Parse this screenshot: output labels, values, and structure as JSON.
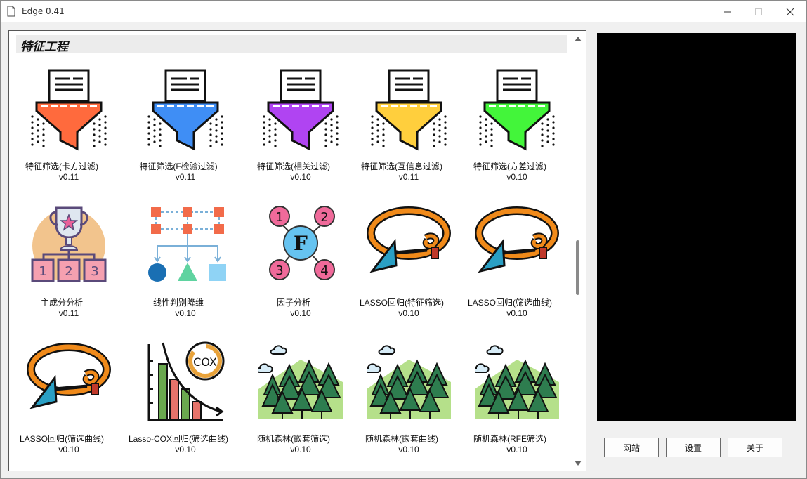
{
  "window": {
    "title": "Edge 0.41"
  },
  "section": {
    "title": "特征工程"
  },
  "items": [
    {
      "name": "特征筛选(卡方过滤)",
      "version": "v0.11",
      "icon": "funnel-filter-icon",
      "color": "#ff6a3d"
    },
    {
      "name": "特征筛选(F检验过滤)",
      "version": "v0.11",
      "icon": "funnel-filter-icon",
      "color": "#3f8ef5"
    },
    {
      "name": "特征筛选(相关过滤)",
      "version": "v0.10",
      "icon": "funnel-filter-icon",
      "color": "#b044f2"
    },
    {
      "name": "特征筛选(互信息过滤)",
      "version": "v0.11",
      "icon": "funnel-filter-icon",
      "color": "#ffcf3d"
    },
    {
      "name": "特征筛选(方差过滤)",
      "version": "v0.10",
      "icon": "funnel-filter-icon",
      "color": "#43f53a"
    },
    {
      "name": "主成分分析",
      "version": "v0.11",
      "icon": "trophy-hierarchy-icon"
    },
    {
      "name": "线性判别降维",
      "version": "v0.10",
      "icon": "classification-tree-icon"
    },
    {
      "name": "因子分析",
      "version": "v0.10",
      "icon": "factor-network-icon"
    },
    {
      "name": "LASSO回归(特征筛选)",
      "version": "v0.10",
      "icon": "lasso-rope-icon"
    },
    {
      "name": "LASSO回归(筛选曲线)",
      "version": "v0.10",
      "icon": "lasso-rope-icon"
    },
    {
      "name": "LASSO回归(筛选曲线)",
      "version": "v0.10",
      "icon": "lasso-rope-icon"
    },
    {
      "name": "Lasso-COX回归(筛选曲线)",
      "version": "v0.10",
      "icon": "cox-chart-icon"
    },
    {
      "name": "随机森林(嵌套筛选)",
      "version": "v0.10",
      "icon": "forest-icon"
    },
    {
      "name": "随机森林(嵌套曲线)",
      "version": "v0.10",
      "icon": "forest-icon"
    },
    {
      "name": "随机森林(RFE筛选)",
      "version": "v0.10",
      "icon": "forest-icon"
    }
  ],
  "buttons": {
    "website": "网站",
    "settings": "设置",
    "about": "关于"
  }
}
